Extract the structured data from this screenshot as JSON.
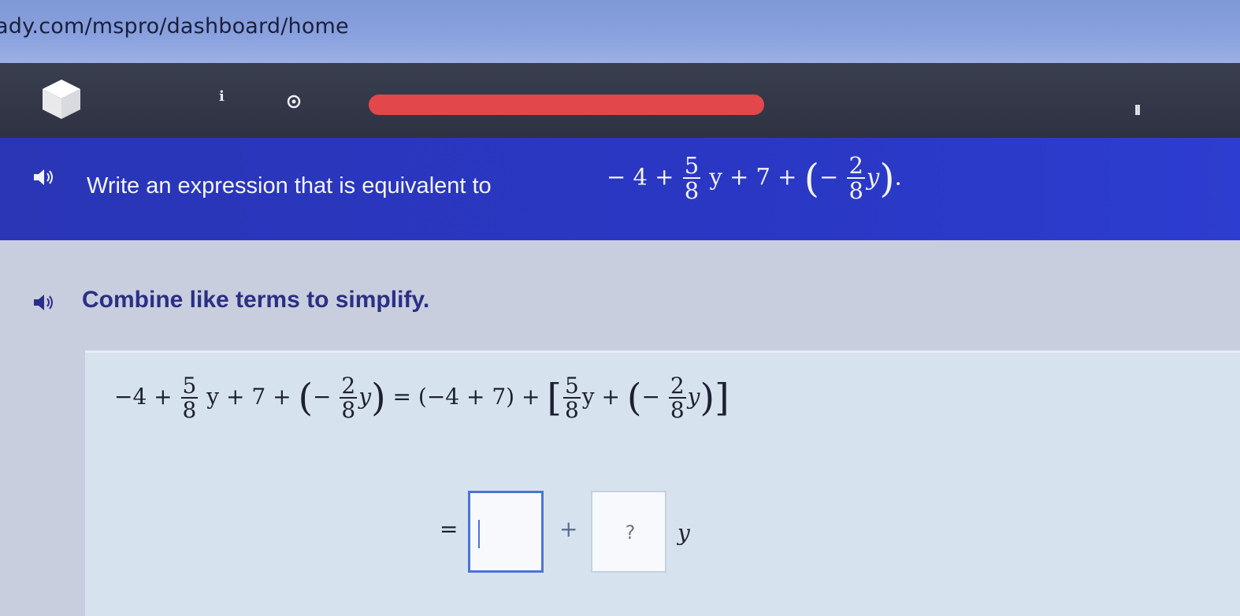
{
  "browser": {
    "url": "ady.com/mspro/dashboard/home"
  },
  "toolbar": {
    "progress_fraction": 1.0,
    "icons": [
      "cube-icon",
      "info-icon",
      "gear-icon",
      "pause-icon"
    ],
    "info_glyph": "i",
    "pause_glyph": "II"
  },
  "question": {
    "prompt": "Write an expression that is equivalent to",
    "expr": {
      "c1": "− 4 +",
      "num1": "5",
      "den1": "8",
      "mid": "y + 7 +",
      "num2": "2",
      "den2": "8",
      "var": "y",
      "end": "."
    }
  },
  "hint": {
    "text": "Combine like terms to simplify."
  },
  "work": {
    "line1": {
      "c1": "−4 +",
      "num1": "5",
      "den1": "8",
      "mid": "y + 7 +",
      "num2": "2",
      "den2": "8",
      "eq": "= (−4 + 7) +",
      "num3": "5",
      "den3": "8",
      "plus": "y +",
      "num4": "2",
      "den4": "8"
    },
    "line2": {
      "equals": "=",
      "plus": "+",
      "var": "y"
    },
    "answer1": {
      "value": "",
      "placeholder": ""
    },
    "answer2": {
      "value": "",
      "placeholder": "?"
    }
  },
  "colors": {
    "url_bar": "#8aa2df",
    "toolbar": "#2d3142",
    "progress": "#e2474b",
    "question_band": "#2a37c4",
    "hint_text": "#2a2f86",
    "work_panel": "#d7e2ef",
    "active_border": "#4a74d6"
  }
}
